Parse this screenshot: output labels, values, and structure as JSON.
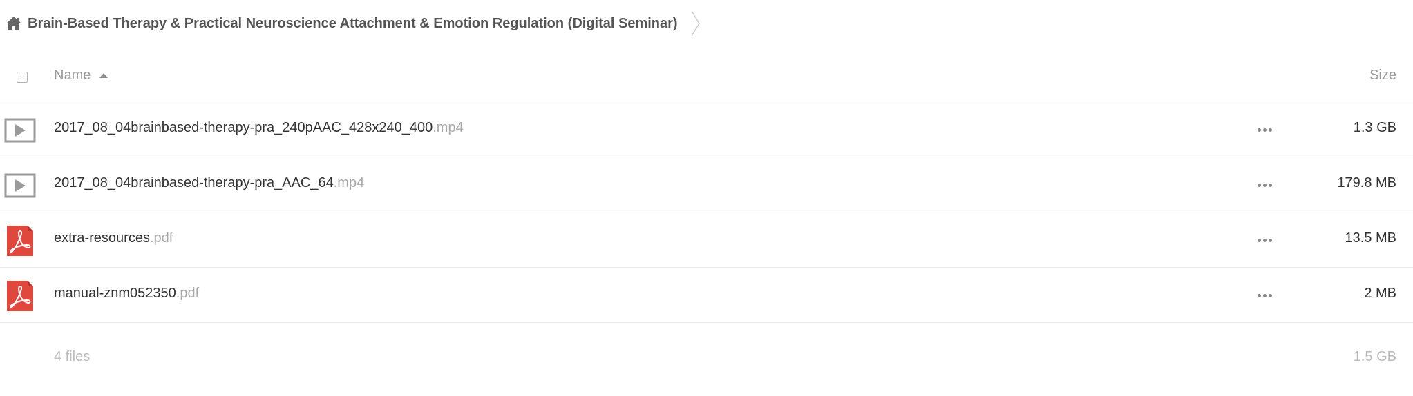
{
  "breadcrumb": {
    "home_icon": "home-icon",
    "title": "Brain-Based Therapy & Practical Neuroscience Attachment & Emotion Regulation (Digital Seminar)",
    "separator_icon": "chevron-right-icon"
  },
  "table": {
    "select_all_icon": "checkbox-icon",
    "column_name": "Name",
    "sort_icon": "sort-ascending-icon",
    "column_size": "Size"
  },
  "files": [
    {
      "icon": "video-file-icon",
      "name": "2017_08_04brainbased-therapy-pra_240pAAC_428x240_400",
      "ext": ".mp4",
      "size": "1.3 GB"
    },
    {
      "icon": "video-file-icon",
      "name": "2017_08_04brainbased-therapy-pra_AAC_64",
      "ext": ".mp4",
      "size": "179.8 MB"
    },
    {
      "icon": "pdf-file-icon",
      "name": "extra-resources",
      "ext": ".pdf",
      "size": "13.5 MB"
    },
    {
      "icon": "pdf-file-icon",
      "name": "manual-znm052350",
      "ext": ".pdf",
      "size": "2 MB"
    }
  ],
  "footer": {
    "count": "4 files",
    "total": "1.5 GB"
  },
  "colors": {
    "pdf_red": "#e0483e",
    "video_gray": "#9a9a9a",
    "text": "#333333",
    "muted": "#999999",
    "border": "#ededed"
  }
}
